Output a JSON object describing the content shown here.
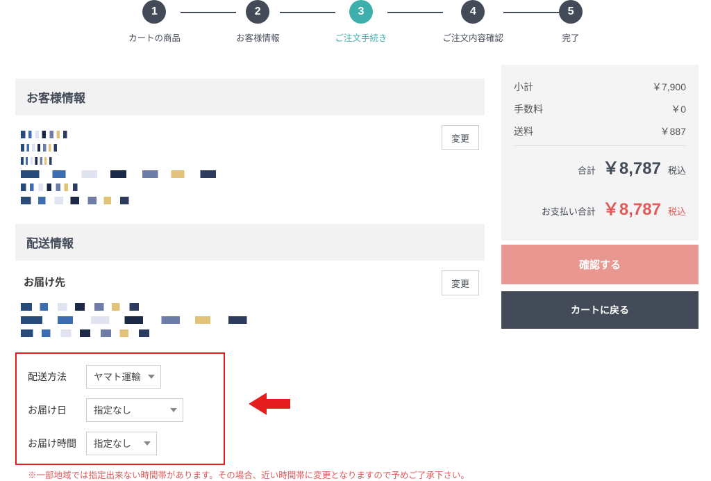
{
  "stepper": {
    "steps": [
      {
        "num": "1",
        "label": "カートの商品",
        "active": false
      },
      {
        "num": "2",
        "label": "お客様情報",
        "active": false
      },
      {
        "num": "3",
        "label": "ご注文手続き",
        "active": true
      },
      {
        "num": "4",
        "label": "ご注文内容確認",
        "active": false
      },
      {
        "num": "5",
        "label": "完了",
        "active": false
      }
    ]
  },
  "sections": {
    "customer_title": "お客様情報",
    "shipping_title": "配送情報",
    "destination_title": "お届け先"
  },
  "buttons": {
    "change": "変更",
    "confirm": "確認する",
    "back": "カートに戻る"
  },
  "summary": {
    "subtotal_label": "小計",
    "subtotal_value": "￥7,900",
    "fee_label": "手数料",
    "fee_value": "￥0",
    "shipfee_label": "送料",
    "shipfee_value": "￥887",
    "total_label": "合計",
    "total_value": "￥8,787",
    "total_suffix": "税込",
    "pay_label": "お支払い合計",
    "pay_value": "￥8,787",
    "pay_suffix": "税込"
  },
  "delivery": {
    "method_label": "配送方法",
    "method_value": "ヤマト運輸",
    "date_label": "お届け日",
    "date_value": "指定なし",
    "time_label": "お届け時間",
    "time_value": "指定なし"
  },
  "note": "※一部地域では指定出来ない時間帯があります。その場合、近い時間帯に変更となりますので予めご了承下さい。"
}
